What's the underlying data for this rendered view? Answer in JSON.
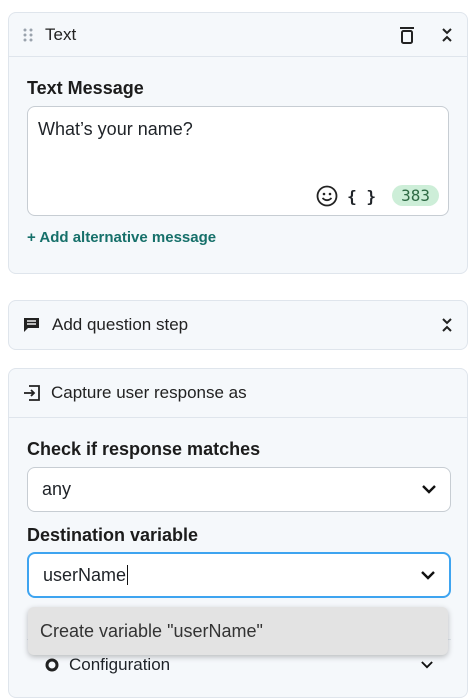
{
  "text_card": {
    "title": "Text",
    "message_label": "Text Message",
    "message_value": "What’s your name?",
    "emoji_icon": "smiley-icon",
    "variables_icon_text": "{ }",
    "char_count": "383",
    "add_alt_link": "+ Add alternative message"
  },
  "question_card": {
    "title": "Add question step"
  },
  "capture_card": {
    "title": "Capture user response as",
    "check_label": "Check if response matches",
    "check_value": "any",
    "dest_label": "Destination variable",
    "dest_value": "userName",
    "dropdown_option": "Create variable \"userName\"",
    "hidden_section_label": "Configuration"
  },
  "colors": {
    "accent_link": "#16706a",
    "focus_border": "#3ea4f0",
    "counter_bg": "#cdeed8"
  }
}
